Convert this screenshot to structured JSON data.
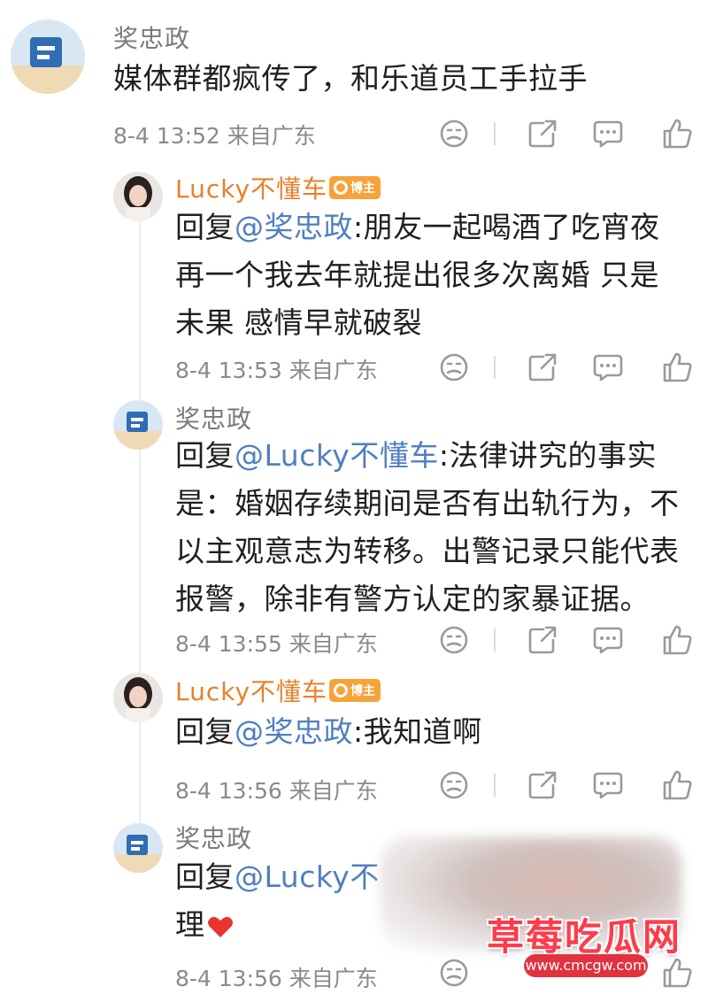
{
  "comments": [
    {
      "user": "奖忠政",
      "text_lines": [
        "媒体群都疯传了，和乐道员工手拉手"
      ],
      "time": "8-4 13:52",
      "location": "来自广东"
    },
    {
      "user": "Lucky不懂车",
      "badge": "博主",
      "reply_prefix": "回复",
      "mention": "@奖忠政",
      "text_first": ":朋友一起喝酒了吃宵夜",
      "text_lines": [
        "再一个我去年就提出很多次离婚 只是",
        "未果 感情早就破裂"
      ],
      "time": "8-4 13:53",
      "location": "来自广东"
    },
    {
      "user": "奖忠政",
      "reply_prefix": "回复",
      "mention": "@Lucky不懂车",
      "text_first": ":法律讲究的事实",
      "text_lines": [
        "是：婚姻存续期间是否有出轨行为，不",
        "以主观意志为转移。出警记录只能代表",
        "报警，除非有警方认定的家暴证据。"
      ],
      "time": "8-4 13:55",
      "location": "来自广东"
    },
    {
      "user": "Lucky不懂车",
      "badge": "博主",
      "reply_prefix": "回复",
      "mention": "@奖忠政",
      "text_first": ":我知道啊",
      "time": "8-4 13:56",
      "location": "来自广东"
    },
    {
      "user": "奖忠政",
      "reply_prefix": "回复",
      "mention": "@Lucky不",
      "text_lines": [
        "理"
      ],
      "time": "8-4 13:56",
      "location": "来自广东"
    }
  ],
  "watermark": {
    "title": "草莓吃瓜网",
    "url": "www.cmcgw.com"
  },
  "icons": [
    "dislike-face-icon",
    "share-icon",
    "comment-icon",
    "like-thumb-icon",
    "heart-icon",
    "blogger-badge-icon"
  ],
  "colors": {
    "mention": "#4f7fc0",
    "blogger_name": "#e8802c",
    "badge": "#f6a33a",
    "heart": "#e8332f"
  }
}
